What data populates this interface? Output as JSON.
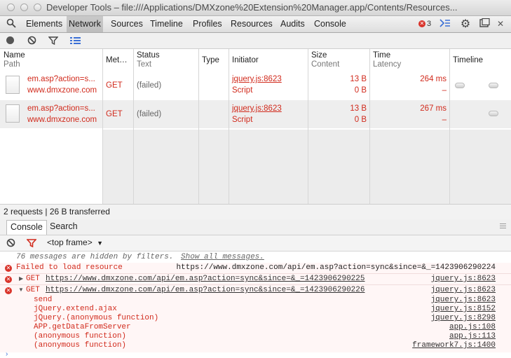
{
  "window": {
    "title": "Developer Tools – file:///Applications/DMXzone%20Extension%20Manager.app/Contents/Resources..."
  },
  "panels": [
    "Elements",
    "Network",
    "Sources",
    "Timeline",
    "Profiles",
    "Resources",
    "Audits",
    "Console"
  ],
  "toolbar": {
    "error_count": "3"
  },
  "columns": {
    "name": "Name",
    "path": "Path",
    "method": "Met…",
    "status": "Status",
    "status_text": "Text",
    "type": "Type",
    "initiator": "Initiator",
    "size": "Size",
    "content": "Content",
    "time": "Time",
    "latency": "Latency",
    "timeline": "Timeline"
  },
  "requests": [
    {
      "name": "em.asp?action=s...",
      "path": "www.dmxzone.com",
      "method": "GET",
      "status": "(failed)",
      "initiator": "jquery.js:8623",
      "initiator_type": "Script",
      "size": "13 B",
      "content": "0 B",
      "time": "264 ms",
      "latency": "–"
    },
    {
      "name": "em.asp?action=s...",
      "path": "www.dmxzone.com",
      "method": "GET",
      "status": "(failed)",
      "initiator": "jquery.js:8623",
      "initiator_type": "Script",
      "size": "13 B",
      "content": "0 B",
      "time": "267 ms",
      "latency": "–"
    }
  ],
  "summary": "2 requests | 26 B transferred",
  "drawer": {
    "tabs": [
      "Console",
      "Search"
    ],
    "frame": "<top frame>",
    "hidden_notice": "76 messages are hidden by filters.",
    "show_all": "Show all messages.",
    "messages": [
      {
        "text": "Failed to load resource",
        "url": "https://www.dmxzone.com/api/em.asp?action=sync&since=&_=1423906290224"
      },
      {
        "method": "GET",
        "url": "https://www.dmxzone.com/api/em.asp?action=sync&since=&_=1423906290225",
        "source": "jquery.js:8623"
      },
      {
        "method": "GET",
        "url": "https://www.dmxzone.com/api/em.asp?action=sync&since=&_=1423906290226",
        "source": "jquery.js:8623"
      }
    ],
    "stack": [
      {
        "fn": "send",
        "source": "jquery.js:8623"
      },
      {
        "fn": "jQuery.extend.ajax",
        "source": "jquery.js:8152"
      },
      {
        "fn": "jQuery.(anonymous function)",
        "source": "jquery.js:8298"
      },
      {
        "fn": "APP.getDataFromServer",
        "source": "app.js:108"
      },
      {
        "fn": "(anonymous function)",
        "source": "app.js:113"
      },
      {
        "fn": "(anonymous function)",
        "source": "framework7.js:1400"
      }
    ]
  }
}
